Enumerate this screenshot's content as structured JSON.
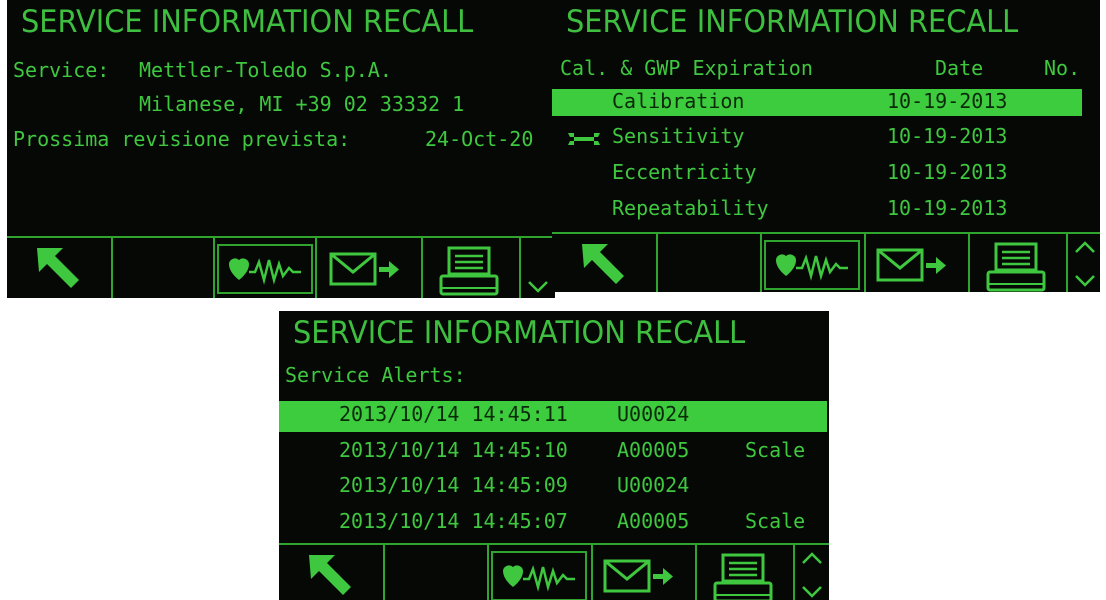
{
  "screen1": {
    "title": "SERVICE INFORMATION RECALL",
    "service_label": "Service:",
    "company": "Mettler-Toledo S.p.A.",
    "address": "Milanese, MI   +39 02 33332 1",
    "next_label": "Prossima revisione prevista:",
    "next_date": "24-Oct-20"
  },
  "screen2": {
    "title": "SERVICE INFORMATION RECALL",
    "col_expiration": "Cal. & GWP Expiration",
    "col_date": "Date",
    "col_no": "No.",
    "rows": [
      {
        "name": "Calibration",
        "date": "10-19-2013"
      },
      {
        "name": "Sensitivity",
        "date": "10-19-2013"
      },
      {
        "name": "Eccentricity",
        "date": "10-19-2013"
      },
      {
        "name": "Repeatability",
        "date": "10-19-2013"
      }
    ]
  },
  "screen3": {
    "title": "SERVICE INFORMATION RECALL",
    "subtitle": "Service Alerts:",
    "rows": [
      {
        "datetime": "2013/10/14  14:45:11",
        "code": "U00024",
        "target": ""
      },
      {
        "datetime": "2013/10/14  14:45:10",
        "code": "A00005",
        "target": "Scale"
      },
      {
        "datetime": "2013/10/14  14:45:09",
        "code": "U00024",
        "target": ""
      },
      {
        "datetime": "2013/10/14  14:45:07",
        "code": "A00005",
        "target": "Scale"
      }
    ]
  },
  "colors": {
    "display_bg": "#050805",
    "text_green": "#3fc83f",
    "highlight": "#3dcc3d"
  },
  "icons": [
    "exit-arrow-icon",
    "heart-pulse-icon",
    "send-mail-icon",
    "printer-icon",
    "scroll-arrows-icon",
    "wrench-icon"
  ]
}
